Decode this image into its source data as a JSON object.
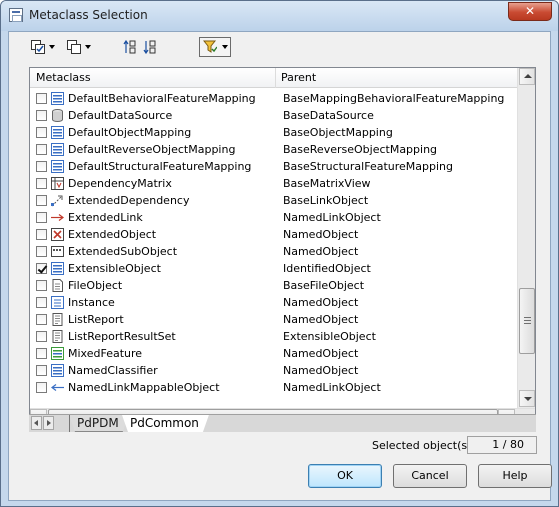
{
  "window": {
    "title": "Metaclass Selection",
    "close_glyph": "✕"
  },
  "toolbar": {
    "buttons": [
      {
        "icon": "select-all-icon",
        "has_dropdown": true
      },
      {
        "icon": "deselect-all-icon",
        "has_dropdown": true
      },
      {
        "icon": "sort-ascending-icon",
        "has_dropdown": false
      },
      {
        "icon": "sort-descending-icon",
        "has_dropdown": false
      },
      {
        "icon": "filter-icon",
        "has_dropdown": true
      }
    ]
  },
  "grid": {
    "columns": [
      "Metaclass",
      "Parent"
    ],
    "rows": [
      {
        "icon": "list-icon",
        "checked": false,
        "name": "DefaultBehavioralFeatureMapping",
        "parent": "BaseMappingBehavioralFeatureMapping"
      },
      {
        "icon": "database-icon",
        "checked": false,
        "name": "DefaultDataSource",
        "parent": "BaseDataSource"
      },
      {
        "icon": "list-icon",
        "checked": false,
        "name": "DefaultObjectMapping",
        "parent": "BaseObjectMapping"
      },
      {
        "icon": "list-icon",
        "checked": false,
        "name": "DefaultReverseObjectMapping",
        "parent": "BaseReverseObjectMapping"
      },
      {
        "icon": "list-icon",
        "checked": false,
        "name": "DefaultStructuralFeatureMapping",
        "parent": "BaseStructuralFeatureMapping"
      },
      {
        "icon": "matrix-icon",
        "checked": false,
        "name": "DependencyMatrix",
        "parent": "BaseMatrixView"
      },
      {
        "icon": "dependency-icon",
        "checked": false,
        "name": "ExtendedDependency",
        "parent": "BaseLinkObject"
      },
      {
        "icon": "red-arrow-icon",
        "checked": false,
        "name": "ExtendedLink",
        "parent": "NamedLinkObject"
      },
      {
        "icon": "extended-object-icon",
        "checked": false,
        "name": "ExtendedObject",
        "parent": "NamedObject"
      },
      {
        "icon": "subobject-icon",
        "checked": false,
        "name": "ExtendedSubObject",
        "parent": "NamedObject"
      },
      {
        "icon": "list-icon",
        "checked": true,
        "name": "ExtensibleObject",
        "parent": "IdentifiedObject"
      },
      {
        "icon": "file-icon",
        "checked": false,
        "name": "FileObject",
        "parent": "BaseFileObject"
      },
      {
        "icon": "instance-icon",
        "checked": false,
        "name": "Instance",
        "parent": "NamedObject"
      },
      {
        "icon": "report-icon",
        "checked": false,
        "name": "ListReport",
        "parent": "NamedObject"
      },
      {
        "icon": "report-icon",
        "checked": false,
        "name": "ListReportResultSet",
        "parent": "ExtensibleObject"
      },
      {
        "icon": "list-green-icon",
        "checked": false,
        "name": "MixedFeature",
        "parent": "NamedObject"
      },
      {
        "icon": "list-icon",
        "checked": false,
        "name": "NamedClassifier",
        "parent": "NamedObject"
      },
      {
        "icon": "blue-arrow-icon",
        "checked": false,
        "name": "NamedLinkMappableObject",
        "parent": "NamedLinkObject"
      }
    ]
  },
  "tabs": [
    {
      "label": "PdPDM",
      "active": false
    },
    {
      "label": "PdCommon",
      "active": true
    }
  ],
  "status": {
    "label": "Selected object(s):",
    "value": "1 / 80"
  },
  "buttons": {
    "ok": "OK",
    "cancel": "Cancel",
    "help": "Help"
  },
  "colors": {
    "title_bar": "#c5d8ec",
    "close_button": "#c94a32",
    "list_icon_blue": "#3a6fc4",
    "list_icon_green": "#3a9a3a",
    "arrow_red": "#c0392b",
    "default_button_border": "#3c7fb1"
  }
}
